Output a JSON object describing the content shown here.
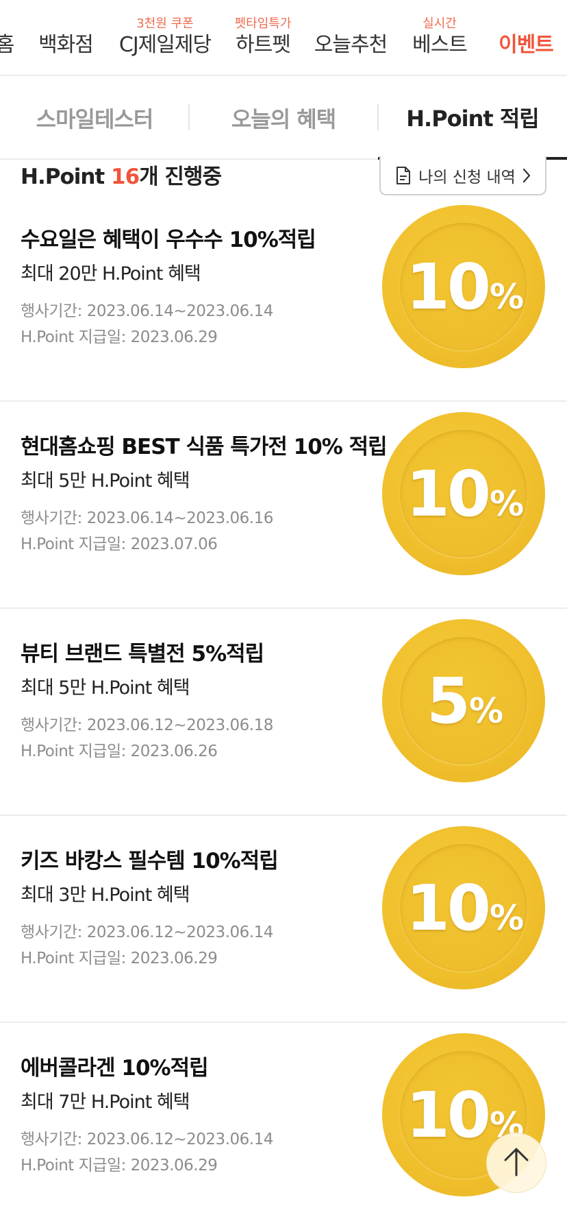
{
  "nav": {
    "items": [
      {
        "label": "홈",
        "badge": ""
      },
      {
        "label": "백화점",
        "badge": ""
      },
      {
        "label": "CJ제일제당",
        "badge": "3천원 쿠폰"
      },
      {
        "label": "하트펫",
        "badge": "펫타임특가"
      },
      {
        "label": "오늘추천",
        "badge": ""
      },
      {
        "label": "베스트",
        "badge": "실시간"
      },
      {
        "label": "이벤트",
        "badge": ""
      }
    ],
    "active": "이벤트"
  },
  "subtabs": {
    "items": [
      "스마일테스터",
      "오늘의 혜택",
      "H.Point 적립"
    ],
    "active": "H.Point 적립"
  },
  "summary": {
    "prefix": "H.Point ",
    "count": "16",
    "suffix": "개 진행중",
    "history_label": "나의 신청 내역"
  },
  "events": [
    {
      "title": "수요일은 혜택이 우수수 10%적립",
      "subtitle": "최대 20만 H.Point 혜택",
      "period": "행사기간: 2023.06.14~2023.06.14",
      "pay_date": "H.Point 지급일: 2023.06.29",
      "coin_num": "10",
      "coin_pct": "%"
    },
    {
      "title": "현대홈쇼핑 BEST 식품 특가전 10% 적립",
      "subtitle": "최대 5만 H.Point 혜택",
      "period": "행사기간: 2023.06.14~2023.06.16",
      "pay_date": "H.Point 지급일: 2023.07.06",
      "coin_num": "10",
      "coin_pct": "%"
    },
    {
      "title": "뷰티 브랜드 특별전 5%적립",
      "subtitle": "최대 5만 H.Point 혜택",
      "period": "행사기간: 2023.06.12~2023.06.18",
      "pay_date": "H.Point 지급일: 2023.06.26",
      "coin_num": "5",
      "coin_pct": "%"
    },
    {
      "title": "키즈 바캉스 필수템 10%적립",
      "subtitle": "최대 3만 H.Point 혜택",
      "period": "행사기간: 2023.06.12~2023.06.14",
      "pay_date": "H.Point 지급일: 2023.06.29",
      "coin_num": "10",
      "coin_pct": "%"
    },
    {
      "title": "에버콜라겐 10%적립",
      "subtitle": "최대 7만 H.Point 혜택",
      "period": "행사기간: 2023.06.12~2023.06.14",
      "pay_date": "H.Point 지급일: 2023.06.29",
      "coin_num": "10",
      "coin_pct": "%"
    }
  ],
  "colors": {
    "accent": "#f0553b",
    "coin": "#f0bf2c"
  },
  "icons": {
    "history": "document-icon",
    "history_arrow": "chevron-right-icon",
    "scroll_top": "arrow-up-icon"
  }
}
